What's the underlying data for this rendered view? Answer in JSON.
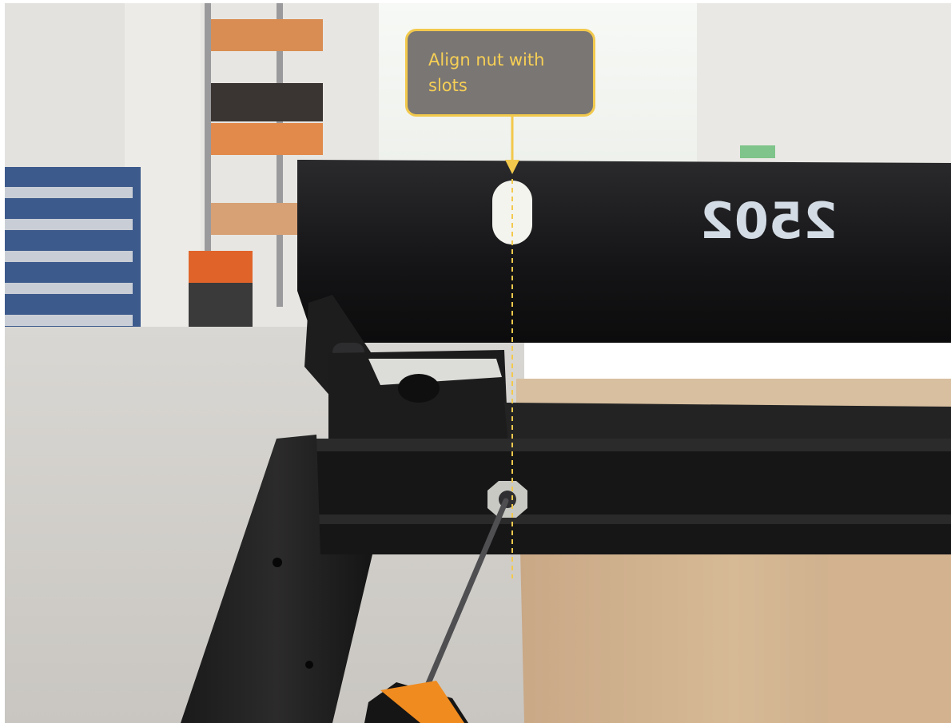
{
  "photo": {
    "subject": "monitor-stand-assembly",
    "embossed_text": "2502"
  },
  "callout": {
    "text": "Align nut with\nslots",
    "colors": {
      "fill": "#7a7674",
      "border": "#f2c94c",
      "text": "#f6cf55",
      "arrow": "#f2c94c",
      "guide_line": "#f2c94c"
    }
  }
}
